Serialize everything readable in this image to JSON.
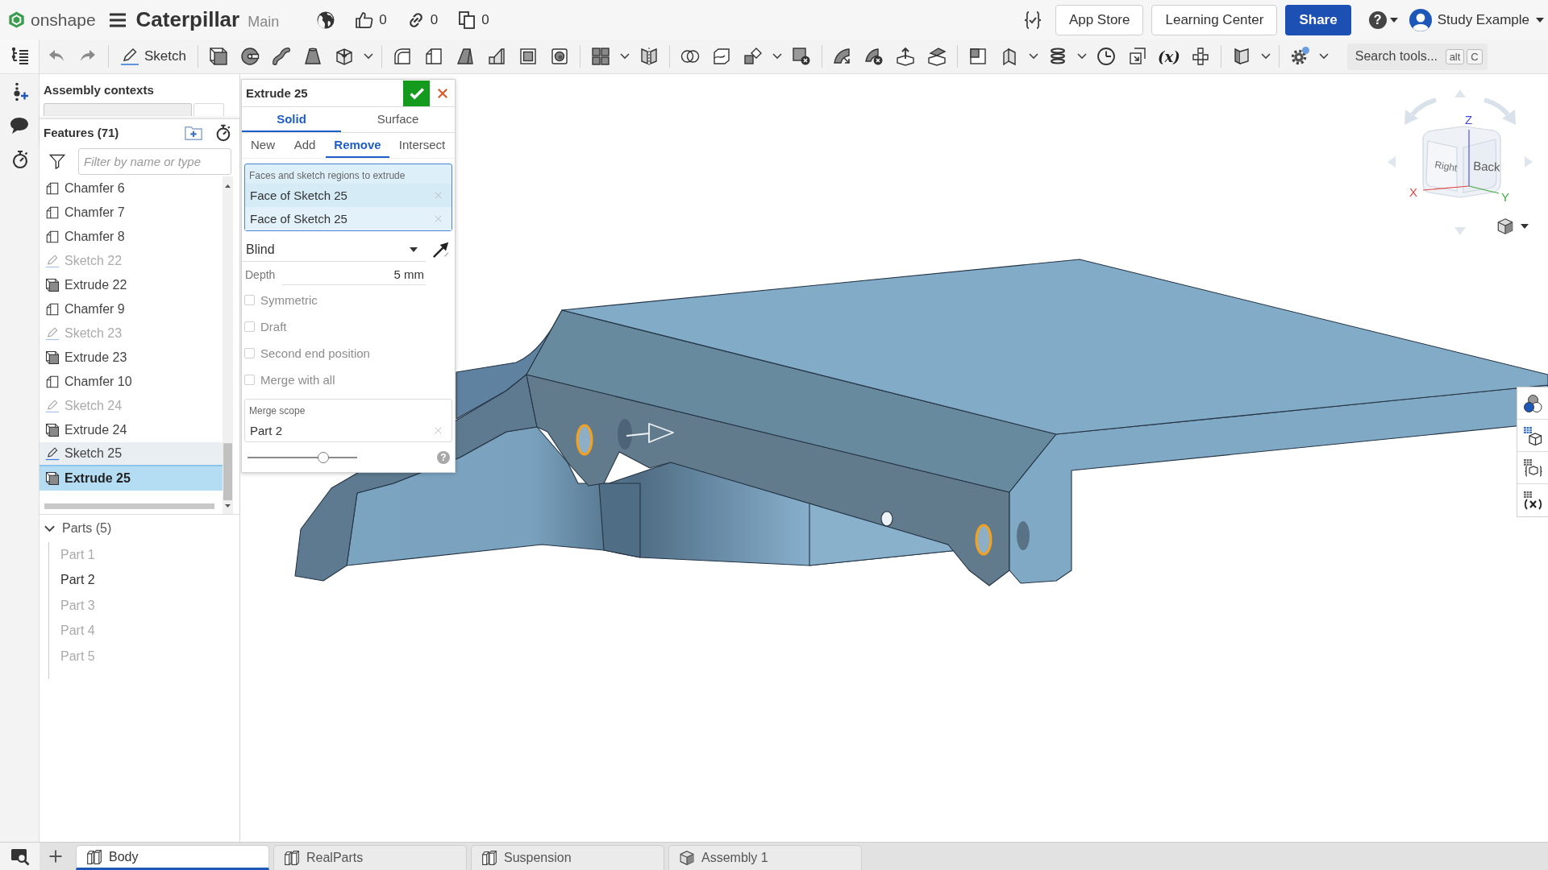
{
  "top_bar": {
    "logo_text": "onshape",
    "document_title": "Caterpillar",
    "workspace": "Main",
    "counters": [
      {
        "kind": "likes",
        "value": "0"
      },
      {
        "kind": "links",
        "value": "0"
      },
      {
        "kind": "copies",
        "value": "0"
      }
    ],
    "buttons": [
      {
        "label": "App Store",
        "kind": "outline"
      },
      {
        "label": "Learning Center",
        "kind": "outline"
      },
      {
        "label": "Share",
        "kind": "primary"
      }
    ],
    "help": "?",
    "user": "Study Example"
  },
  "toolbar": {
    "sketch_button": "Sketch",
    "variables_button": "(x)",
    "search": {
      "placeholder": "Search tools...",
      "keys": [
        "alt",
        "C"
      ]
    }
  },
  "assembly_contexts": {
    "title": "Assembly contexts"
  },
  "features": {
    "title": "Features (71)",
    "filter": {
      "placeholder": "Filter by name or type"
    },
    "items": [
      {
        "label": "Chamfer 6",
        "kind": "chamfer",
        "dimmed": false,
        "highlighted": false,
        "selected": false
      },
      {
        "label": "Chamfer 7",
        "kind": "chamfer",
        "dimmed": false,
        "highlighted": false,
        "selected": false
      },
      {
        "label": "Chamfer 8",
        "kind": "chamfer",
        "dimmed": false,
        "highlighted": false,
        "selected": false
      },
      {
        "label": "Sketch 22",
        "kind": "sketch",
        "dimmed": true,
        "highlighted": false,
        "selected": false
      },
      {
        "label": "Extrude 22",
        "kind": "extrude",
        "dimmed": false,
        "highlighted": false,
        "selected": false
      },
      {
        "label": "Chamfer 9",
        "kind": "chamfer",
        "dimmed": false,
        "highlighted": false,
        "selected": false
      },
      {
        "label": "Sketch 23",
        "kind": "sketch",
        "dimmed": true,
        "highlighted": false,
        "selected": false
      },
      {
        "label": "Extrude 23",
        "kind": "extrude",
        "dimmed": false,
        "highlighted": false,
        "selected": false
      },
      {
        "label": "Chamfer 10",
        "kind": "chamfer",
        "dimmed": false,
        "highlighted": false,
        "selected": false
      },
      {
        "label": "Sketch 24",
        "kind": "sketch",
        "dimmed": true,
        "highlighted": false,
        "selected": false
      },
      {
        "label": "Extrude 24",
        "kind": "extrude",
        "dimmed": false,
        "highlighted": false,
        "selected": false
      },
      {
        "label": "Sketch 25",
        "kind": "sketch",
        "dimmed": false,
        "highlighted": true,
        "selected": false
      },
      {
        "label": "Extrude 25",
        "kind": "extrude",
        "dimmed": false,
        "highlighted": false,
        "selected": true
      }
    ]
  },
  "parts": {
    "title": "Parts (5)",
    "expanded": true,
    "items": [
      {
        "label": "Part 1",
        "dimmed": true,
        "selected": false
      },
      {
        "label": "Part 2",
        "dimmed": false,
        "selected": false
      },
      {
        "label": "Part 3",
        "dimmed": true,
        "selected": false
      },
      {
        "label": "Part 4",
        "dimmed": true,
        "selected": false
      },
      {
        "label": "Part 5",
        "dimmed": true,
        "selected": false
      }
    ]
  },
  "feature_dialog": {
    "title": "Extrude 25",
    "body_types": [
      {
        "label": "Solid",
        "selected": true
      },
      {
        "label": "Surface",
        "selected": false
      }
    ],
    "operations": [
      {
        "label": "New",
        "selected": false
      },
      {
        "label": "Add",
        "selected": false
      },
      {
        "label": "Remove",
        "selected": true
      },
      {
        "label": "Intersect",
        "selected": false
      }
    ],
    "selections": {
      "label": "Faces and sketch regions to extrude",
      "items": [
        "Face of Sketch 25",
        "Face of Sketch 25"
      ]
    },
    "end_type": "Blind",
    "depth": {
      "label": "Depth",
      "value": "5 mm"
    },
    "options": [
      {
        "label": "Symmetric",
        "checked": false
      },
      {
        "label": "Draft",
        "checked": false
      },
      {
        "label": "Second end position",
        "checked": false
      },
      {
        "label": "Merge with all",
        "checked": false
      }
    ],
    "merge_scope": {
      "label": "Merge scope",
      "items": [
        "Part 2"
      ]
    },
    "slider": {
      "level": 0.69
    },
    "help": "?"
  },
  "view_cube": {
    "faces": [
      "Right",
      "Back"
    ],
    "axes": [
      {
        "label": "X",
        "color": "#e04848"
      },
      {
        "label": "Y",
        "color": "#3cac3c"
      },
      {
        "label": "Z",
        "color": "#4848e0"
      }
    ]
  },
  "document_tabs": [
    {
      "label": "Body",
      "kind": "part_studio",
      "selected": true
    },
    {
      "label": "RealParts",
      "kind": "part_studio",
      "selected": false
    },
    {
      "label": "Suspension",
      "kind": "part_studio",
      "selected": false
    },
    {
      "label": "Assembly 1",
      "kind": "assembly",
      "selected": false
    }
  ]
}
